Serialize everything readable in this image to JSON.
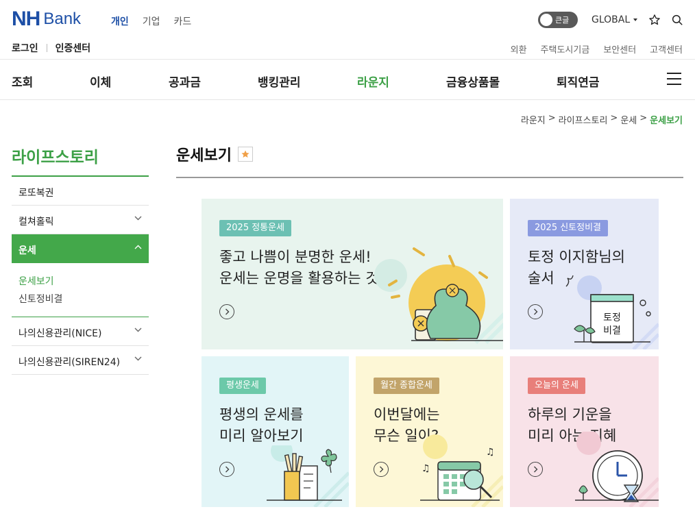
{
  "brand": {
    "nh": "NH",
    "bank": "Bank"
  },
  "segments": [
    {
      "label": "개인",
      "active": true
    },
    {
      "label": "기업",
      "active": false
    },
    {
      "label": "카드",
      "active": false
    }
  ],
  "top_utils": {
    "bigtext_label": "큰글",
    "global_label": "GLOBAL",
    "icons": [
      "star-icon",
      "search-icon"
    ]
  },
  "account_links": [
    "로그인",
    "인증센터"
  ],
  "util_links": [
    "외환",
    "주택도시기금",
    "보안센터",
    "고객센터"
  ],
  "gnb": [
    {
      "label": "조회",
      "active": false
    },
    {
      "label": "이체",
      "active": false
    },
    {
      "label": "공과금",
      "active": false
    },
    {
      "label": "뱅킹관리",
      "active": false
    },
    {
      "label": "라운지",
      "active": true
    },
    {
      "label": "금융상품몰",
      "active": false
    },
    {
      "label": "퇴직연금",
      "active": false
    }
  ],
  "breadcrumb": {
    "items": [
      "라운지",
      "라이프스토리",
      "운세"
    ],
    "current": "운세보기",
    "sep": ">"
  },
  "lnb": {
    "title": "라이프스토리",
    "items": [
      {
        "label": "로또복권"
      },
      {
        "label": "컬쳐홀릭"
      },
      {
        "label": "운세"
      },
      {
        "label": "나의신용관리(NICE)"
      },
      {
        "label": "나의신용관리(SIREN24)"
      }
    ],
    "sub_items": [
      {
        "label": "운세보기",
        "active": true
      },
      {
        "label": "신토정비결",
        "active": false
      }
    ]
  },
  "page": {
    "title": "운세보기"
  },
  "cards": [
    {
      "badge": "2025 정통운세",
      "line1": "좋고 나쁨이 분명한 운세!",
      "line2": "운세는 운명을 활용하는 것",
      "bg": "#e8f4ee",
      "badge_color": "#6cc0b3"
    },
    {
      "badge": "2025 신토정비결",
      "line1": "토정 이지함님의",
      "line2": "술서",
      "art_text1": "토정",
      "art_text2": "비결",
      "bg": "#e6eaf7",
      "badge_color": "#8a9ae0"
    },
    {
      "badge": "평생운세",
      "line1": "평생의 운세를",
      "line2": "미리 알아보기",
      "bg": "#e2f5f7",
      "badge_color": "#6cc9a9"
    },
    {
      "badge": "월간 종합운세",
      "line1": "이번달에는",
      "line2": "무슨 일이?",
      "bg": "#fdf7d6",
      "badge_color": "#c2a46a"
    },
    {
      "badge": "오늘의 운세",
      "line1": "하루의 기운을",
      "line2": "미리 아는 지혜",
      "bg": "#f8e2e8",
      "badge_color": "#e87f7a"
    }
  ]
}
